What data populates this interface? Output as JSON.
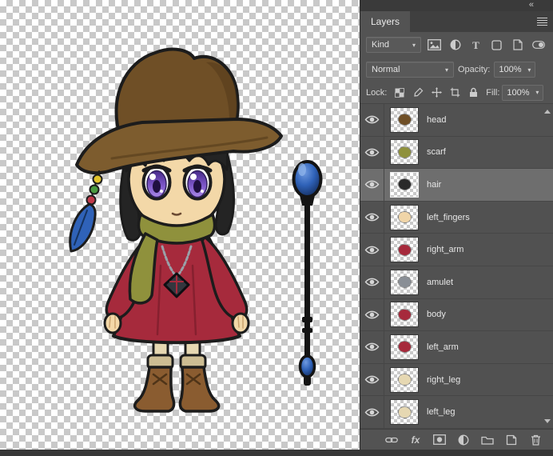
{
  "panel": {
    "title": "Layers",
    "filter": {
      "kind_label": "Kind"
    },
    "blend": {
      "mode": "Normal",
      "opacity_label": "Opacity:",
      "opacity_value": "100%"
    },
    "lock": {
      "label": "Lock:",
      "fill_label": "Fill:",
      "fill_value": "100%"
    },
    "layers": [
      {
        "name": "head",
        "selected": false,
        "thumb": "#6f4f26"
      },
      {
        "name": "scarf",
        "selected": false,
        "thumb": "#8f913c"
      },
      {
        "name": "hair",
        "selected": true,
        "thumb": "#2a2a2a"
      },
      {
        "name": "left_fingers",
        "selected": false,
        "thumb": "#f0d5a8"
      },
      {
        "name": "right_arm",
        "selected": false,
        "thumb": "#a62a3c"
      },
      {
        "name": "amulet",
        "selected": false,
        "thumb": "#8a8f96"
      },
      {
        "name": "body",
        "selected": false,
        "thumb": "#a62a3c"
      },
      {
        "name": "left_arm",
        "selected": false,
        "thumb": "#a62a3c"
      },
      {
        "name": "right_leg",
        "selected": false,
        "thumb": "#e6d8b2"
      },
      {
        "name": "left_leg",
        "selected": false,
        "thumb": "#e6d8b2"
      }
    ],
    "footer": {
      "fx_label": "fx"
    }
  },
  "icons": {
    "collapse": "«",
    "chevron": "▾"
  },
  "colors": {
    "panel_bg": "#535353",
    "selected_row": "#6e6e6e",
    "canvas_checker": "#c9c9c9",
    "staff_blue": "#2f62b8",
    "dress_red": "#a62a3c",
    "hat_brown": "#6f4f26",
    "scarf_olive": "#8f913c",
    "eye_purple": "#7d57c8"
  }
}
